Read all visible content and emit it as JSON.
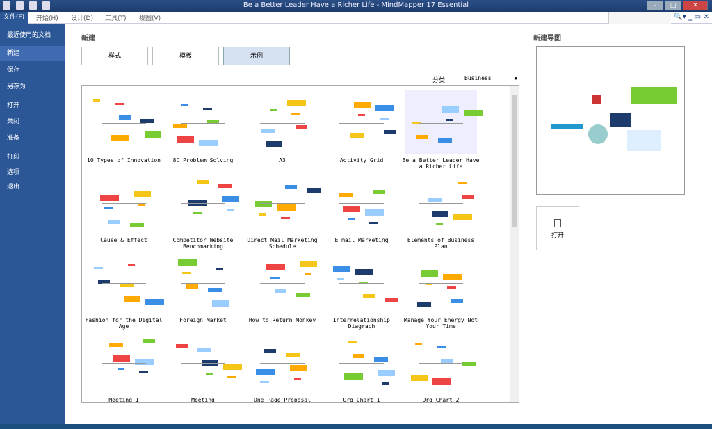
{
  "title": "Be a Better Leader  Have a Richer Life - MindMapper 17 Essential",
  "menu": [
    "文件(F)",
    "开始(H)",
    "设计(D)",
    "工具(T)",
    "视图(V)"
  ],
  "sidebar": [
    "最近使用的文档",
    "新建",
    "保存",
    "另存为",
    "打开",
    "关闭",
    "准备",
    "打印",
    "选项",
    "退出"
  ],
  "section_title": "新建",
  "tabs": [
    "样式",
    "模板",
    "示例"
  ],
  "category_label": "分类:",
  "category_value": "Business",
  "items": [
    "10 Types of Innovation",
    "8D  Problem Solving",
    "A3",
    "Activity Grid",
    "Be a Better Leader  Have a Richer Life",
    "Cause & Effect",
    "Competitor Website Benchmarking",
    "Direct Mail Marketing Schedule",
    "E mail Marketing",
    "Elements of  Business Plan",
    "Fashion for the Digital Age",
    "Foreign Market",
    "How to Return Monkey",
    "Interrelationship Diagraph",
    "Manage Your Energy  Not Your Time",
    "Meeting 1",
    "Meeting",
    "One Page Proposal",
    "Org Chart 1",
    "Org Chart 2"
  ],
  "preview_title": "新建导图",
  "open_label": "打开"
}
